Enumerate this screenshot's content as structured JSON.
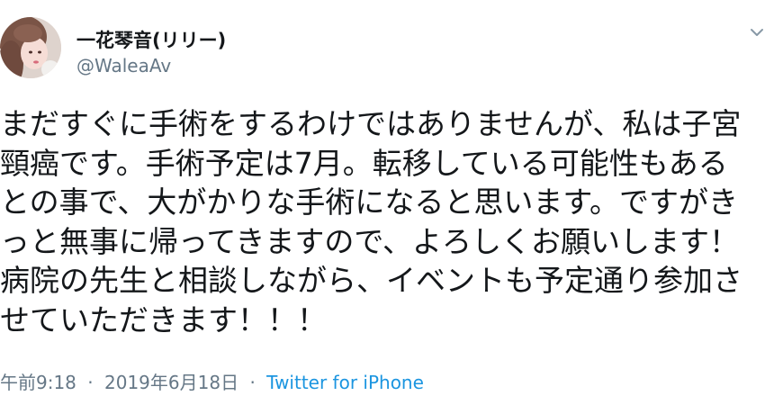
{
  "user": {
    "display_name": "一花琴音(リリー)",
    "handle": "@WaleaAv"
  },
  "tweet": {
    "lines": [
      "まだすぐに手術をするわけではありませんが、私は子宮",
      "頸癌です。手術予定は7月。転移している可能性もある",
      "との事で、大がかりな手術になると思います。ですがき",
      "っと無事に帰ってきますので、よろしくお願いします！",
      "病院の先生と相談しながら、イベントも予定通り参加さ",
      "せていただきます！！！"
    ]
  },
  "meta": {
    "time": "午前9:18",
    "separator": "·",
    "date": "2019年6月18日",
    "source": "Twitter for iPhone"
  },
  "icons": {
    "menu": "chevron-down-icon",
    "avatar": "profile-photo"
  },
  "colors": {
    "text": "#14171a",
    "secondary": "#657786",
    "link": "#1b95e0"
  }
}
